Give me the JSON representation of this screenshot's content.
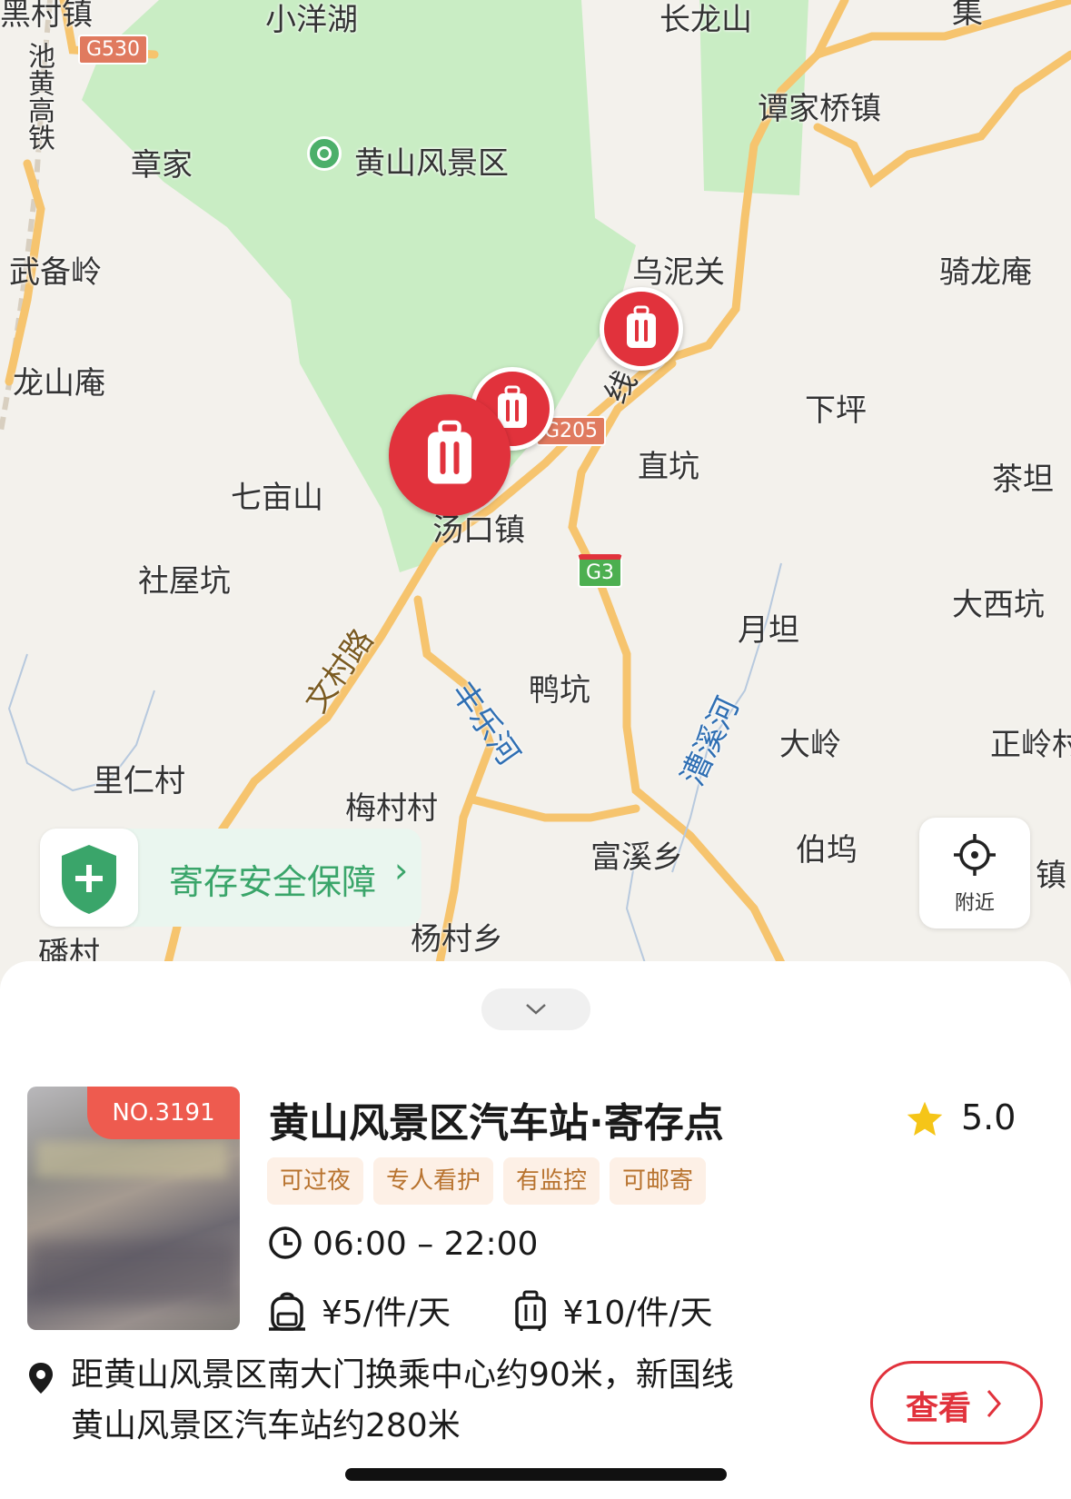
{
  "map": {
    "labels": {
      "heicun": "黑村镇",
      "xiaoyanghu": "小洋湖",
      "changlongshan": "长龙山",
      "jiao": "集",
      "chihuang": "池黄高铁",
      "tanjiaqiao": "谭家桥镇",
      "zhangjia": "章家",
      "scenic": "黄山风景区",
      "wubeiling": "武备岭",
      "wuniguan": "乌泥关",
      "qilongan": "骑龙庵",
      "longshanan": "龙山庵",
      "xiaping": "下坪",
      "xian": "线",
      "zhikeng": "直坑",
      "chatan": "茶坦",
      "qimushan": "七亩山",
      "tangkou": "汤口镇",
      "shewukeng": "社屋坑",
      "yuetan": "月坦",
      "daxikeng": "大西坑",
      "wencunlu": "文村路",
      "fengleyhe": "丰乐河",
      "yakeng": "鸭坑",
      "caoxihe": "漕溪河",
      "daling": "大岭",
      "zhengling": "正岭村",
      "lirencun": "里仁村",
      "meicuncun": "梅村村",
      "fuxixiang": "富溪乡",
      "bowu": "伯坞",
      "zhen": "镇",
      "yangcunxiang": "杨村乡",
      "fancun": "磻村"
    },
    "shields": {
      "g530": "G530",
      "g205": "G205",
      "g3": "G3"
    },
    "safety_banner": "寄存安全保障",
    "locate_label": "附近",
    "colors": {
      "scenic_green": "#c9edc4",
      "road_yellow": "#f6c46e",
      "pin_red": "#e1323c"
    }
  },
  "detail": {
    "badge": "NO.3191",
    "title": "黄山风景区汽车站·寄存点",
    "rating": "5.0",
    "tags": [
      "可过夜",
      "专人看护",
      "有监控",
      "可邮寄"
    ],
    "hours": "06:00 – 22:00",
    "price_small": "¥5/件/天",
    "price_large": "¥10/件/天",
    "address": "距黄山风景区南大门换乘中心约90米，新国线黄山风景区汽车站约280米",
    "view_button": "查看"
  }
}
